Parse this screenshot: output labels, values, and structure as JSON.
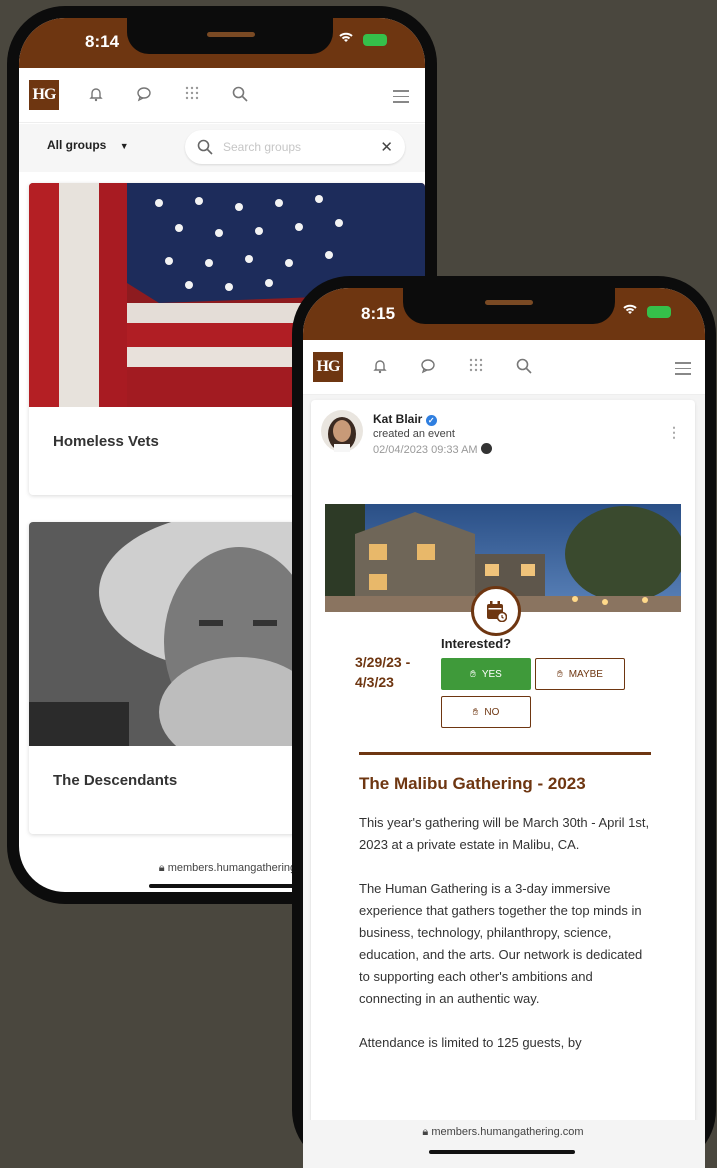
{
  "back_phone": {
    "time": "8:14",
    "nav": {
      "logo": "HG"
    },
    "filter": {
      "group_select": "All groups",
      "search_placeholder": "Search groups"
    },
    "cards": [
      {
        "title": "Homeless Vets"
      },
      {
        "title": "The Descendants"
      }
    ],
    "url": "members.humangathering."
  },
  "front_phone": {
    "time": "8:15",
    "nav": {
      "logo": "HG"
    },
    "post": {
      "author": "Kat Blair",
      "action": "created an event",
      "timestamp": "02/04/2023 09:33 AM"
    },
    "event": {
      "dates": "3/29/23 - 4/3/23",
      "interested_label": "Interested?",
      "yes": "YES",
      "maybe": "MAYBE",
      "no": "NO",
      "title": "The Malibu Gathering - 2023",
      "paragraphs": [
        "This year's gathering will be March 30th - April 1st, 2023 at a private estate in Malibu, CA.",
        "The Human Gathering is a 3-day immersive experience that gathers together the top minds in business, technology, philanthropy, science, education, and the arts. Our network is dedicated to supporting each other's ambitions and connecting in an authentic way.",
        "Attendance is limited to 125 guests, by"
      ]
    },
    "url": "members.humangathering.com"
  },
  "colors": {
    "brand": "#6e3611",
    "yes_green": "#3f9a3a",
    "background": "#4a473e"
  }
}
